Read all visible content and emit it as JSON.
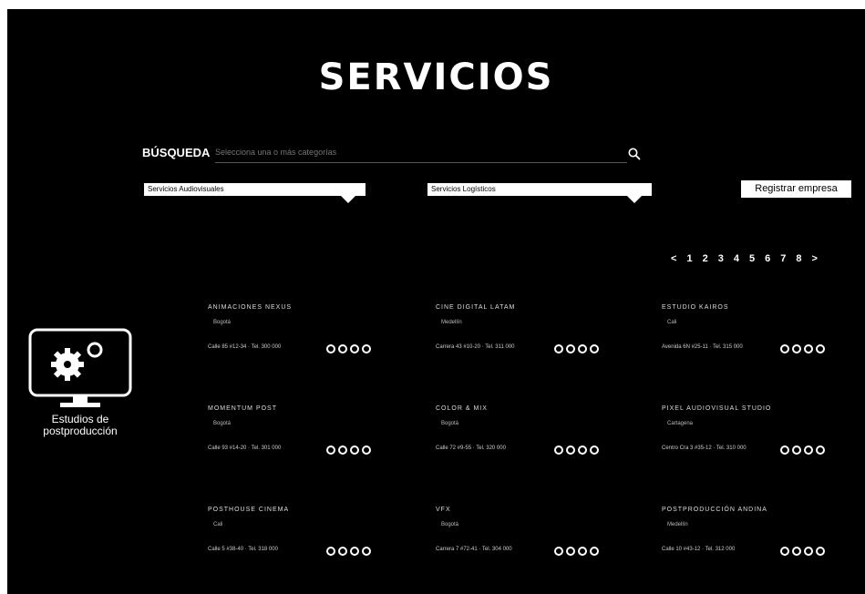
{
  "page": {
    "title": "SERVICIOS"
  },
  "search": {
    "label": "BÚSQUEDA",
    "placeholder": "Selecciona una o más categorías"
  },
  "filters": [
    {
      "label": "Servicios Audiovisuales"
    },
    {
      "label": "Servicios Logísticos"
    }
  ],
  "register_label": "Registrar empresa",
  "pagination": {
    "prev": "<",
    "pages": [
      "1",
      "2",
      "3",
      "4",
      "5",
      "6",
      "7",
      "8"
    ],
    "next": ">"
  },
  "category": {
    "name": "Estudios de postproducción",
    "icon": "monitor-gears-icon"
  },
  "cards": [
    {
      "name": "ANIMACIONES NEXUS",
      "sub": "Bogotá",
      "detail": "Calle 85 #12-34 · Tel. 300 000",
      "rating": 4
    },
    {
      "name": "CINE DIGITAL LATAM",
      "sub": "Medellín",
      "detail": "Carrera 43 #10-20 · Tel. 311 000",
      "rating": 4
    },
    {
      "name": "ESTUDIO KAIROS",
      "sub": "Cali",
      "detail": "Avenida 6N #25-11 · Tel. 315 000",
      "rating": 4
    },
    {
      "name": "MOMENTUM POST",
      "sub": "Bogotá",
      "detail": "Calle 93 #14-20 · Tel. 301 000",
      "rating": 4
    },
    {
      "name": "COLOR & MIX",
      "sub": "Bogotá",
      "detail": "Calle 72 #9-55 · Tel. 320 000",
      "rating": 4
    },
    {
      "name": "PIXEL AUDIOVISUAL STUDIO",
      "sub": "Cartagena",
      "detail": "Centro Cra 3 #35-12 · Tel. 310 000",
      "rating": 4
    },
    {
      "name": "POSTHOUSE CINEMA",
      "sub": "Cali",
      "detail": "Calle 5 #38-40 · Tel. 318 000",
      "rating": 4
    },
    {
      "name": "VFX",
      "sub": "Bogotá",
      "detail": "Carrera 7 #72-41 · Tel. 304 000",
      "rating": 4
    },
    {
      "name": "POSTPRODUCCIÓN ANDINA",
      "sub": "Medellín",
      "detail": "Calle 10 #43-12 · Tel. 312 000",
      "rating": 4
    }
  ]
}
